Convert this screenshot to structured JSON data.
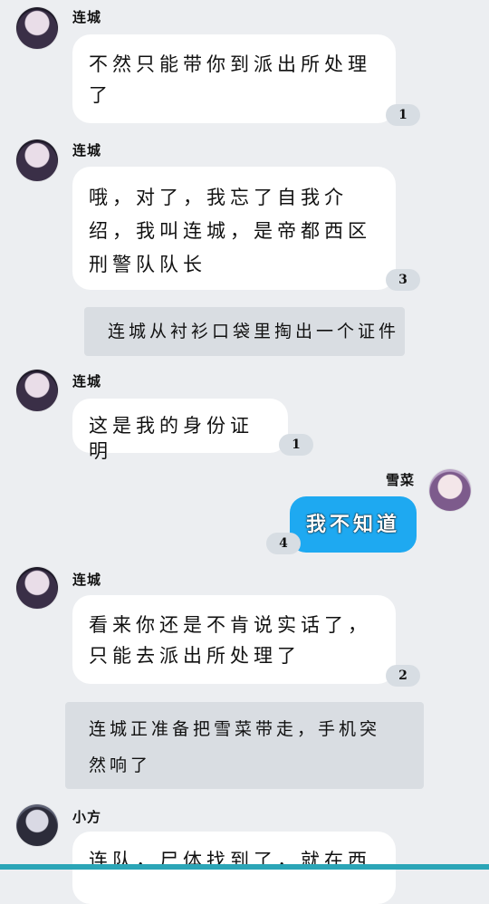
{
  "messages": [
    {
      "name": "连城",
      "text": "不然只能带你到派出所处理了",
      "count": "1"
    },
    {
      "name": "连城",
      "text": "哦，对了，我忘了自我介绍，我叫连城，是帝都西区刑警队队长",
      "count": "3"
    },
    {
      "name": "连城",
      "text": "这是我的身份证明",
      "count": "1"
    },
    {
      "name": "雪菜",
      "text": "我不知道",
      "count": "4"
    },
    {
      "name": "连城",
      "text": "看来你还是不肯说实话了，只能去派出所处理了",
      "count": "2"
    },
    {
      "name": "小方",
      "text": "连队，尸体找到了，就在西"
    }
  ],
  "narrations": [
    "连城从衬衫口袋里掏出一个证件",
    "连城正准备把雪菜带走，手机突然响了"
  ],
  "colors": {
    "background": "#eceef1",
    "self_bubble": "#1ea9f1",
    "bottom_bar": "#2ba5b7"
  }
}
